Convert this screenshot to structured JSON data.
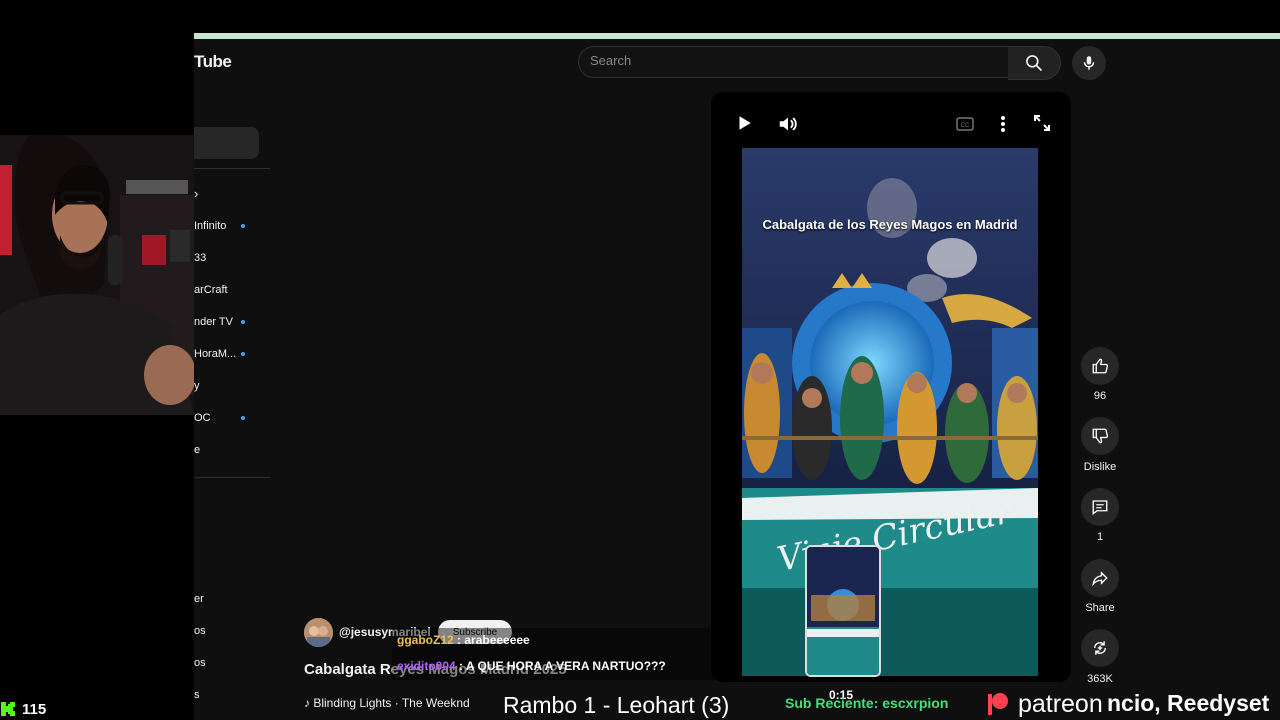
{
  "youtube": {
    "logo_text": "Tube",
    "search_placeholder": "Search"
  },
  "sidebar": {
    "items": [
      {
        "label": "Infinito",
        "dot": true
      },
      {
        "label": "33",
        "dot": false
      },
      {
        "label": "arCraft",
        "dot": false
      },
      {
        "label": "nder TV",
        "dot": true
      },
      {
        "label": "HoraM...",
        "dot": true
      },
      {
        "label": "y",
        "dot": false
      },
      {
        "label": "OC",
        "dot": true
      },
      {
        "label": "e",
        "dot": false
      }
    ],
    "lower_items": [
      "er",
      "os",
      "os",
      "s"
    ]
  },
  "video": {
    "overlay_title": "Cabalgata de los Reyes Magos en Madrid",
    "preview_time": "0:15"
  },
  "actions": {
    "likes": "96",
    "dislike": "Dislike",
    "comments": "1",
    "share": "Share",
    "remix_count": "363K"
  },
  "channel": {
    "handle": "@jesusymaribel",
    "subscribe": "Subscribe"
  },
  "short": {
    "title": "Cabalgata Reyes Magos Madrid 2025",
    "music": "Blinding Lights · The Weeknd"
  },
  "stream_overlay": {
    "chat": [
      {
        "user": "ggaboZ12",
        "message": "arabeeeeee",
        "color": "#f0c050"
      },
      {
        "user": "exidito004",
        "message": "A QUE HORA A VERA NARTUO???",
        "color": "#b060ff"
      }
    ],
    "now_playing": "Rambo 1 - Leohart (3)",
    "sub_recent": "Sub Reciente: escxrpion",
    "patreon": "patreon",
    "ticker": "ncio, Reedyset",
    "kick_viewers": "115",
    "kick_color": "#53fc18",
    "patreon_color": "#ff424d"
  }
}
